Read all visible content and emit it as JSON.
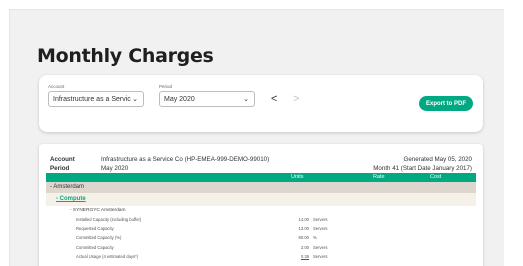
{
  "page": {
    "title": "Monthly Charges"
  },
  "filters": {
    "account_label": "Account",
    "account_value": "Infrastructure as a Servic",
    "period_label": "Period",
    "period_value": "May 2020",
    "export_label": "Export to PDF",
    "prev_arrow": "<",
    "next_arrow": ">",
    "chevron": "⌄"
  },
  "report": {
    "account_label": "Account",
    "account_value": "Infrastructure as a Service Co (HP-EMEA-999-DEMO-99010)",
    "generated": "Generated May 05, 2020",
    "period_label": "Period",
    "period_value": "May 2020",
    "month_info": "Month 41 (Start Date January 2017)",
    "columns": {
      "units": "Units",
      "rate": "Rate",
      "cost": "Cost"
    },
    "location": "- Amsterdam",
    "service": "- Compute",
    "group": "- SYNERGYC Amsterdam",
    "items": [
      {
        "name": "Installed Capacity (including buffer)",
        "qty": "14.00",
        "unit": "Servers"
      },
      {
        "name": "Requested Capacity",
        "qty": "13.00",
        "unit": "Servers"
      },
      {
        "name": "Committed Capacity (%)",
        "qty": "80.00",
        "unit": "%"
      },
      {
        "name": "Committed Capacity",
        "qty": "2.00",
        "unit": "Servers"
      },
      {
        "name": "Actual Usage (4 estimated days*)",
        "qty": "0.39",
        "unit": "Servers"
      }
    ]
  },
  "colors": {
    "accent": "#01a982",
    "location_band": "#dcd6cf",
    "service_band": "#f6f1e8"
  }
}
